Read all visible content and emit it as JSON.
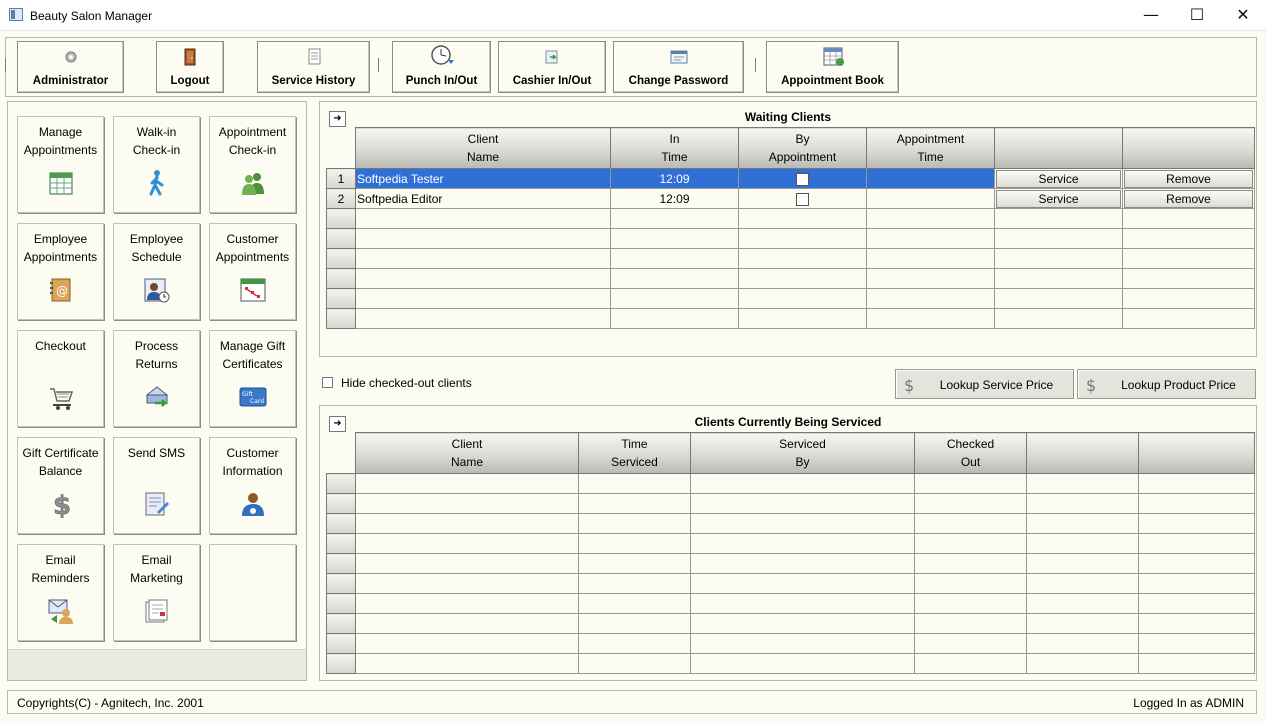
{
  "window": {
    "title": "Beauty Salon Manager",
    "controls": {
      "minimize": "—",
      "maximize": "☐",
      "close": "✕"
    }
  },
  "toolbar": {
    "buttons": [
      {
        "label": "Administrator",
        "icon": "gear-icon"
      },
      {
        "label": "Logout",
        "icon": "door-icon"
      },
      {
        "label": "Service History",
        "icon": "document-icon"
      },
      {
        "label": "Punch In/Out",
        "icon": "clock-icon"
      },
      {
        "label": "Cashier In/Out",
        "icon": "cash-register-icon"
      },
      {
        "label": "Change Password",
        "icon": "password-form-icon"
      },
      {
        "label": "Appointment Book",
        "icon": "calendar-book-icon"
      }
    ]
  },
  "sidebar": {
    "tiles": [
      {
        "label": "Manage\nAppointments",
        "icon": "calendar-icon"
      },
      {
        "label": "Walk-in\nCheck-in",
        "icon": "walking-person-icon"
      },
      {
        "label": "Appointment\nCheck-in",
        "icon": "people-icon"
      },
      {
        "label": "Employee\nAppointments",
        "icon": "address-book-icon"
      },
      {
        "label": "Employee\nSchedule",
        "icon": "schedule-person-icon"
      },
      {
        "label": "Customer\nAppointments",
        "icon": "customer-calendar-icon"
      },
      {
        "label": "Checkout",
        "icon": "shopping-cart-icon"
      },
      {
        "label": "Process\nReturns",
        "icon": "return-basket-icon"
      },
      {
        "label": "Manage Gift\nCertificates",
        "icon": "gift-card-icon"
      },
      {
        "label": "Gift Certificate\nBalance",
        "icon": "dollar-icon"
      },
      {
        "label": "Send SMS",
        "icon": "sms-icon"
      },
      {
        "label": "Customer\nInformation",
        "icon": "customer-icon"
      },
      {
        "label": "Email\nReminders",
        "icon": "email-reminder-icon"
      },
      {
        "label": "Email\nMarketing",
        "icon": "email-marketing-icon"
      },
      {
        "label": "",
        "icon": ""
      }
    ]
  },
  "gift_card_text": "Gift Card",
  "waiting": {
    "title": "Waiting Clients",
    "columns": [
      "Client\nName",
      "In\nTime",
      "By\nAppointment",
      "Appointment\nTime",
      "",
      ""
    ],
    "rows": [
      {
        "num": "1",
        "name": "Softpedia Tester",
        "in_time": "12:09",
        "by_appointment": false,
        "appt_time": "",
        "service": "Service",
        "remove": "Remove"
      },
      {
        "num": "2",
        "name": "Softpedia Editor",
        "in_time": "12:09",
        "by_appointment": false,
        "appt_time": "",
        "service": "Service",
        "remove": "Remove"
      }
    ]
  },
  "hide_checked_out": {
    "label": "Hide checked-out clients",
    "checked": false
  },
  "lookup": {
    "service_price": "Lookup Service Price",
    "product_price": "Lookup Product Price"
  },
  "serviced": {
    "title": "Clients Currently Being Serviced",
    "columns": [
      "Client\nName",
      "Time\nServiced",
      "Serviced\nBy",
      "Checked\nOut",
      "",
      ""
    ]
  },
  "status": {
    "copyright": "Copyrights(C) - Agnitech, Inc. 2001",
    "login": "Logged In as ADMIN"
  },
  "colors": {
    "background": "#fdfcf3",
    "selection": "#2f6fd6"
  }
}
